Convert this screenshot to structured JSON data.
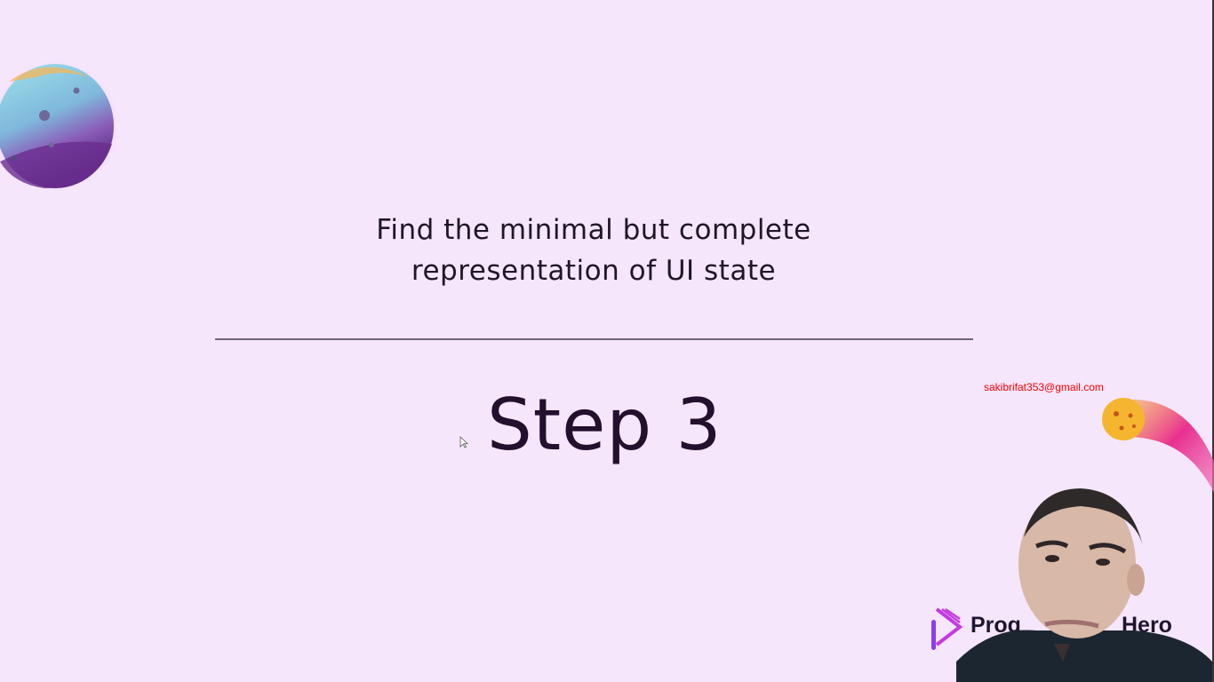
{
  "slide": {
    "headline_line1": "Find the minimal but complete",
    "headline_line2": "representation of UI state",
    "step_title": "Step 3"
  },
  "overlay": {
    "watermark_email": "sakibrifat353@gmail.com"
  },
  "brand": {
    "logo_text_left": "Prog",
    "logo_text_right": "Hero"
  },
  "colors": {
    "background": "#f5e6fc",
    "watermark": "#ff0000",
    "text": "#1f1728"
  }
}
